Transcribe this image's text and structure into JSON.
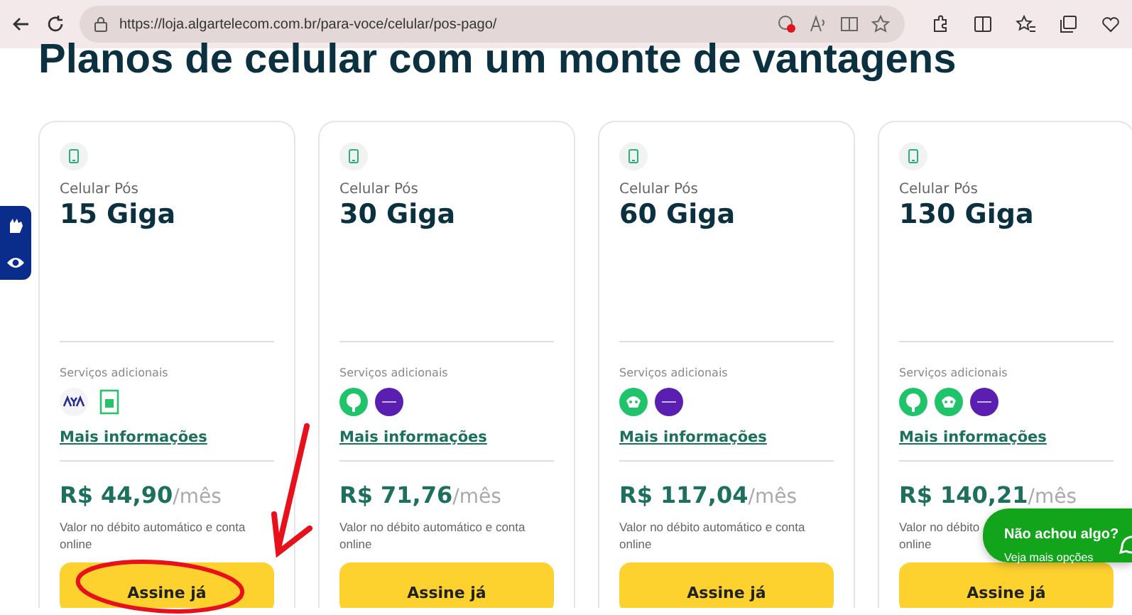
{
  "browser": {
    "url": "https://loja.algartelecom.com.br/para-voce/celular/pos-pago/"
  },
  "heading": "Planos de celular com um monte de vantagens",
  "accessibility_bar": {
    "kind": "accessibility"
  },
  "plans": [
    {
      "category": "Celular Pós",
      "name": "15 Giga",
      "services_label": "Serviços adicionais",
      "services": [
        {
          "kind": "aya"
        },
        {
          "kind": "green-book"
        }
      ],
      "more_link": "Mais informações",
      "price": "R$ 44,90",
      "period": "/mês",
      "note_lines": [
        "Valor no débito automático e conta",
        "online"
      ],
      "button": "Assine já"
    },
    {
      "category": "Celular Pós",
      "name": "30 Giga",
      "services_label": "Serviços adicionais",
      "services": [
        {
          "kind": "green-leaf"
        },
        {
          "kind": "purple-circle"
        }
      ],
      "more_link": "Mais informações",
      "price": "R$ 71,76",
      "period": "/mês",
      "note_lines": [
        "Valor no débito automático e conta",
        "online"
      ],
      "button": "Assine já"
    },
    {
      "category": "Celular Pós",
      "name": "60 Giga",
      "services_label": "Serviços adicionais",
      "services": [
        {
          "kind": "green-face"
        },
        {
          "kind": "purple-circle"
        }
      ],
      "more_link": "Mais informações",
      "price": "R$ 117,04",
      "period": "/mês",
      "note_lines": [
        "Valor no débito automático e conta",
        "online"
      ],
      "button": "Assine já"
    },
    {
      "category": "Celular Pós",
      "name": "130 Giga",
      "services_label": "Serviços adicionais",
      "services": [
        {
          "kind": "green-leaf"
        },
        {
          "kind": "green-face"
        },
        {
          "kind": "purple-circle"
        }
      ],
      "more_link": "Mais informações",
      "price": "R$ 140,21",
      "period": "/mês",
      "note_lines": [
        "Valor no débito",
        "online"
      ],
      "button": "Assine já"
    }
  ],
  "chat_bubble": {
    "title": "Não achou algo?",
    "subtitle": "Veja mais opções"
  },
  "annotation": {
    "kind": "arrow-circle"
  }
}
